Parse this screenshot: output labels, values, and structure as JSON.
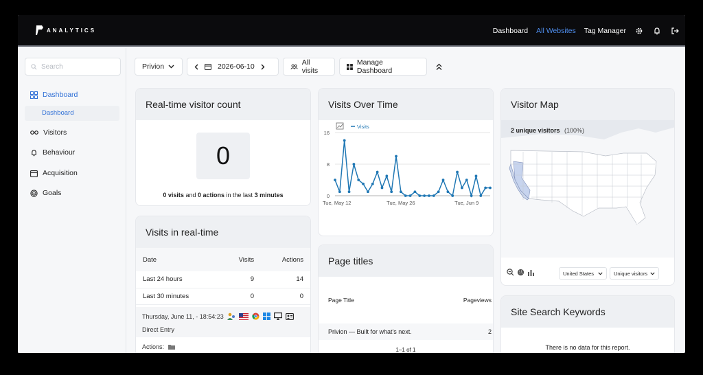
{
  "brand": {
    "logo_text": "ANALYTICS"
  },
  "nav": {
    "links": [
      "Dashboard",
      "All Websites",
      "Tag Manager"
    ],
    "active": "All Websites",
    "icons": [
      "gear-icon",
      "bell-icon",
      "logout-icon"
    ]
  },
  "sidebar": {
    "search_placeholder": "Search",
    "items": [
      {
        "label": "Dashboard",
        "icon": "grid-icon",
        "active": true
      },
      {
        "label": "Visitors",
        "icon": "glasses-icon"
      },
      {
        "label": "Behaviour",
        "icon": "bell-icon"
      },
      {
        "label": "Acquisition",
        "icon": "calendar-icon"
      },
      {
        "label": "Goals",
        "icon": "target-icon"
      }
    ],
    "sub_item": "Dashboard"
  },
  "toolbar": {
    "site": "Privion",
    "date": "2026-06-10",
    "segment": "All visits",
    "manage": "Manage Dashboard"
  },
  "realtime_count": {
    "title": "Real-time visitor count",
    "value": "0",
    "visits": "0 visits",
    "and": "and",
    "actions": "0 actions",
    "in_last": "in the last",
    "minutes": "3 minutes"
  },
  "visits_realtime": {
    "title": "Visits in real-time",
    "headers": [
      "Date",
      "Visits",
      "Actions"
    ],
    "rows": [
      {
        "label": "Last 24 hours",
        "visits": "9",
        "actions": "14"
      },
      {
        "label": "Last 30 minutes",
        "visits": "0",
        "actions": "0"
      }
    ],
    "detail_time": "Thursday, June 11, - 18:54:23",
    "detail_entry": "Direct Entry",
    "detail_actions": "Actions:"
  },
  "visits_over_time": {
    "title": "Visits Over Time",
    "legend": "Visits"
  },
  "chart_data": {
    "type": "line",
    "title": "Visits Over Time",
    "xlabel": "",
    "ylabel": "",
    "ylim": [
      0,
      16
    ],
    "yticks": [
      "0",
      "8",
      "16"
    ],
    "xticks": [
      "Tue, May 12",
      "Tue, May 26",
      "Tue, Jun 9"
    ],
    "grid": true,
    "legend": "top-left",
    "series": [
      {
        "name": "Visits",
        "color": "#1f77b4",
        "values": [
          4,
          1,
          14,
          1,
          8,
          4,
          3,
          1,
          3,
          6,
          2,
          5,
          1,
          10,
          1,
          0,
          0,
          1,
          0,
          0,
          0,
          0,
          1,
          4,
          1,
          0,
          6,
          2,
          4,
          0,
          5,
          0,
          2,
          2
        ]
      }
    ]
  },
  "visitor_map": {
    "title": "Visitor Map",
    "summary": "2 unique visitors",
    "summary_pct": "(100%)",
    "region_select": "United States",
    "metric_select": "Unique visitors"
  },
  "page_titles": {
    "title": "Page titles",
    "headers": [
      "Page Title",
      "Pageviews"
    ],
    "rows": [
      {
        "title": "Privion — Built for what's next.",
        "views": "2"
      }
    ],
    "pagination": "1–1 of 1"
  },
  "site_search": {
    "title": "Site Search Keywords",
    "empty": "There is no data for this report."
  }
}
